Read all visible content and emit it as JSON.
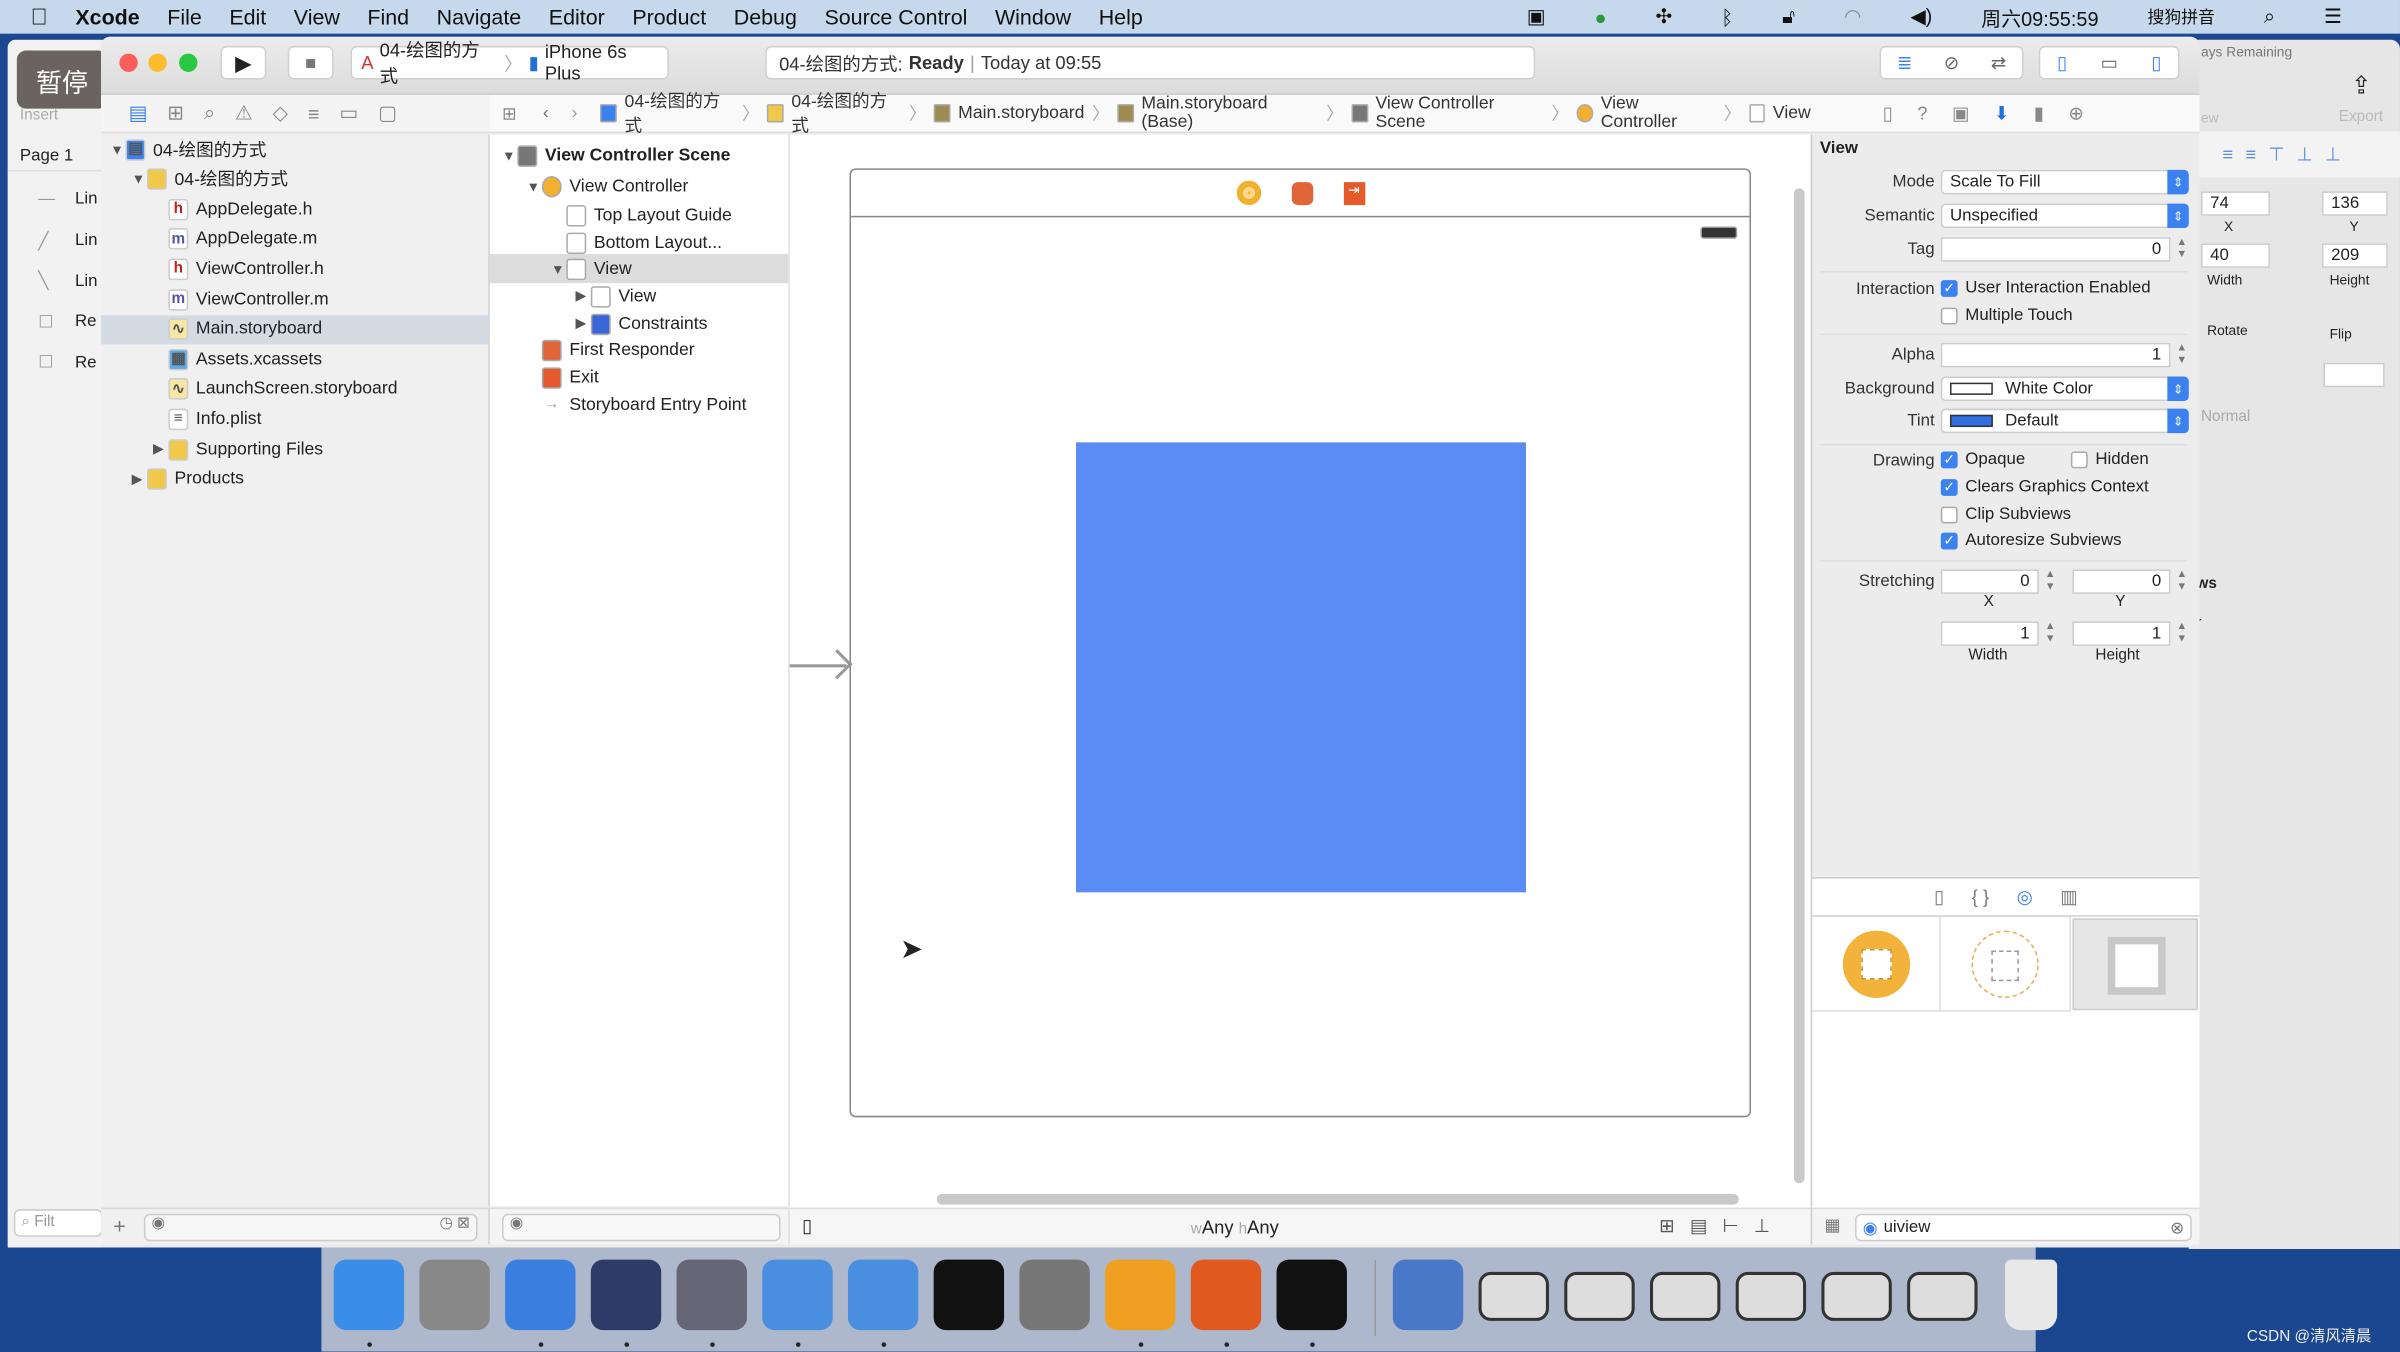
{
  "menubar": {
    "app": "Xcode",
    "items": [
      "File",
      "Edit",
      "View",
      "Find",
      "Navigate",
      "Editor",
      "Product",
      "Debug",
      "Source Control",
      "Window",
      "Help"
    ],
    "clock": "周六09:55:59",
    "input_method": "搜狗拼音"
  },
  "overlay": {
    "pause_label": "暂停"
  },
  "toolbar": {
    "scheme": "04-绘图的方式",
    "device": "iPhone 6s Plus",
    "activity_project": "04-绘图的方式:",
    "activity_status": "Ready",
    "activity_time": "Today at 09:55"
  },
  "back_window_left": {
    "insert": "Insert",
    "page": "Page 1",
    "items": [
      "Lin",
      "Lin",
      "Lin",
      "Re",
      "Re"
    ],
    "filter": "Filt"
  },
  "back_window_right": {
    "days": "ays Remaining",
    "export": "Export",
    "view": "ew",
    "x": "74",
    "y": "136",
    "width": "40",
    "height": "209",
    "x_label": "X",
    "y_label": "Y",
    "width_label": "Width",
    "height_label": "Height",
    "rotate": "Rotate",
    "flip": "Flip",
    "normal": "Normal",
    "ws": "ws",
    "r": "r"
  },
  "navigator": {
    "tree": [
      {
        "label": "04-绘图的方式",
        "level": 0,
        "icon": "project",
        "open": true
      },
      {
        "label": "04-绘图的方式",
        "level": 1,
        "icon": "folder",
        "open": true
      },
      {
        "label": "AppDelegate.h",
        "level": 2,
        "icon": "h"
      },
      {
        "label": "AppDelegate.m",
        "level": 2,
        "icon": "m"
      },
      {
        "label": "ViewController.h",
        "level": 2,
        "icon": "h"
      },
      {
        "label": "ViewController.m",
        "level": 2,
        "icon": "m"
      },
      {
        "label": "Main.storyboard",
        "level": 2,
        "icon": "storyboard",
        "selected": true
      },
      {
        "label": "Assets.xcassets",
        "level": 2,
        "icon": "assets"
      },
      {
        "label": "LaunchScreen.storyboard",
        "level": 2,
        "icon": "storyboard"
      },
      {
        "label": "Info.plist",
        "level": 2,
        "icon": "plist"
      },
      {
        "label": "Supporting Files",
        "level": 2,
        "icon": "folder",
        "closed": true
      },
      {
        "label": "Products",
        "level": 1,
        "icon": "folder",
        "closed": true
      }
    ]
  },
  "jumpbar": [
    "04-绘图的方式",
    "04-绘图的方式",
    "Main.storyboard",
    "Main.storyboard (Base)",
    "View Controller Scene",
    "View Controller",
    "View"
  ],
  "outline": [
    {
      "label": "View Controller Scene",
      "level": 0,
      "open": true,
      "bold": true,
      "icon": "scene"
    },
    {
      "label": "View Controller",
      "level": 1,
      "open": true,
      "icon": "vc"
    },
    {
      "label": "Top Layout Guide",
      "level": 2,
      "icon": "guide"
    },
    {
      "label": "Bottom Layout...",
      "level": 2,
      "icon": "guide"
    },
    {
      "label": "View",
      "level": 2,
      "open": true,
      "selected": true,
      "icon": "view"
    },
    {
      "label": "View",
      "level": 3,
      "closed": true,
      "icon": "view"
    },
    {
      "label": "Constraints",
      "level": 3,
      "closed": true,
      "icon": "constraints"
    },
    {
      "label": "First Responder",
      "level": 1,
      "icon": "responder"
    },
    {
      "label": "Exit",
      "level": 1,
      "icon": "exit"
    },
    {
      "label": "Storyboard Entry Point",
      "level": 1,
      "icon": "arrow"
    }
  ],
  "canvas": {
    "size_class_w": "Any",
    "size_class_h": "Any",
    "w_prefix": "w",
    "h_prefix": "h",
    "subview_color": "#5b8cf5"
  },
  "inspector": {
    "section": "View",
    "mode_label": "Mode",
    "mode": "Scale To Fill",
    "semantic_label": "Semantic",
    "semantic": "Unspecified",
    "tag_label": "Tag",
    "tag": "0",
    "interaction_label": "Interaction",
    "user_interaction": {
      "label": "User Interaction Enabled",
      "checked": true
    },
    "multiple_touch": {
      "label": "Multiple Touch",
      "checked": false
    },
    "alpha_label": "Alpha",
    "alpha": "1",
    "background_label": "Background",
    "background": "White Color",
    "tint_label": "Tint",
    "tint": "Default",
    "tint_color": "#2f6fe0",
    "drawing_label": "Drawing",
    "opaque": {
      "label": "Opaque",
      "checked": true
    },
    "hidden": {
      "label": "Hidden",
      "checked": false
    },
    "clears": {
      "label": "Clears Graphics Context",
      "checked": true
    },
    "clip": {
      "label": "Clip Subviews",
      "checked": false
    },
    "autoresize": {
      "label": "Autoresize Subviews",
      "checked": true
    },
    "stretching_label": "Stretching",
    "stretch_x": "0",
    "stretch_y": "0",
    "stretch_w": "1",
    "stretch_h": "1",
    "x_label": "X",
    "y_label": "Y",
    "width_label": "Width",
    "height_label": "Height"
  },
  "library": {
    "filter": "uiview"
  },
  "watermark": "CSDN @清风清晨"
}
